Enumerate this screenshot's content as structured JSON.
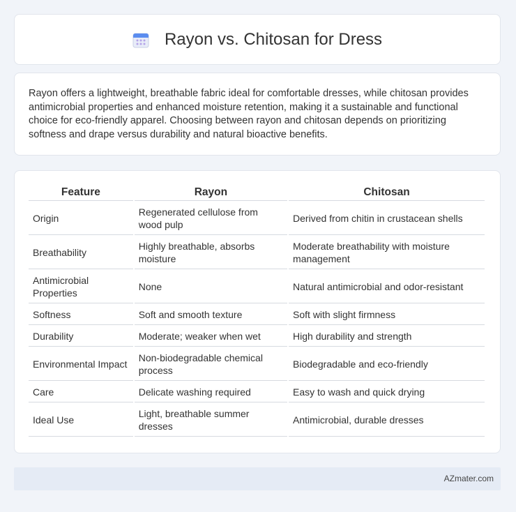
{
  "header": {
    "title": "Rayon vs. Chitosan for Dress",
    "icon": "calendar-icon"
  },
  "intro": {
    "text": "Rayon offers a lightweight, breathable fabric ideal for comfortable dresses, while chitosan provides antimicrobial properties and enhanced moisture retention, making it a sustainable and functional choice for eco-friendly apparel. Choosing between rayon and chitosan depends on prioritizing softness and drape versus durability and natural bioactive benefits."
  },
  "table": {
    "headers": [
      "Feature",
      "Rayon",
      "Chitosan"
    ],
    "rows": [
      [
        "Origin",
        "Regenerated cellulose from wood pulp",
        "Derived from chitin in crustacean shells"
      ],
      [
        "Breathability",
        "Highly breathable, absorbs moisture",
        "Moderate breathability with moisture management"
      ],
      [
        "Antimicrobial Properties",
        "None",
        "Natural antimicrobial and odor-resistant"
      ],
      [
        "Softness",
        "Soft and smooth texture",
        "Soft with slight firmness"
      ],
      [
        "Durability",
        "Moderate; weaker when wet",
        "High durability and strength"
      ],
      [
        "Environmental Impact",
        "Non-biodegradable chemical process",
        "Biodegradable and eco-friendly"
      ],
      [
        "Care",
        "Delicate washing required",
        "Easy to wash and quick drying"
      ],
      [
        "Ideal Use",
        "Light, breathable summer dresses",
        "Antimicrobial, durable dresses"
      ]
    ]
  },
  "footer": {
    "text": "AZmater.com"
  },
  "colors": {
    "background": "#f1f4f9",
    "card": "#ffffff",
    "footer": "#e5ebf5",
    "icon_accent": "#5b8def"
  }
}
